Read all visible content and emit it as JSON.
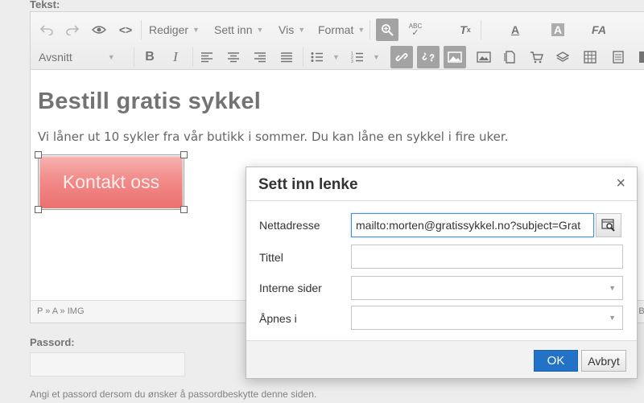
{
  "form": {
    "tekst_label": "Tekst:",
    "passord_label": "Passord:",
    "passord_value": "",
    "passord_hint": "Angi et passord dersom du ønsker å passordbeskytte denne siden."
  },
  "toolbar": {
    "menus": {
      "rediger": "Rediger",
      "sett_inn": "Sett inn",
      "vis": "Vis",
      "format": "Format"
    },
    "block_format": "Avsnitt",
    "source_code_glyph": "<>",
    "bold_glyph": "B",
    "italic_glyph": "I",
    "spellcheck_glyph": "ABC",
    "icons": [
      "undo-icon",
      "redo-icon",
      "preview-icon",
      "source-code-icon",
      "search-replace-icon",
      "spellcheck-icon",
      "clear-format-icon",
      "text-color-icon",
      "background-color-icon",
      "font-size-icon",
      "bold-icon",
      "italic-icon",
      "align-left-icon",
      "align-center-icon",
      "align-right-icon",
      "justify-icon",
      "bullet-list-icon",
      "numbered-list-icon",
      "link-icon",
      "unlink-icon",
      "image-icon",
      "media-icon",
      "template-icon",
      "cart-icon",
      "layers-icon",
      "table-icon",
      "document-icon"
    ]
  },
  "content": {
    "heading": "Bestill gratis sykkel",
    "paragraph": "Vi låner ut 10 sykler fra vår butikk i sommer. Du kan låne en sykkel i fire uker.",
    "image_button_text": "Kontakt oss"
  },
  "statusbar": {
    "path": "P » A » IMG",
    "right": "BY"
  },
  "dialog": {
    "title": "Sett inn lenke",
    "close_glyph": "×",
    "fields": {
      "url_label": "Nettadresse",
      "url_value": "mailto:morten@gratissykkel.no?subject=Grat",
      "title_label": "Tittel",
      "title_value": "",
      "internal_label": "Interne sider",
      "internal_value": "",
      "target_label": "Åpnes i",
      "target_value": ""
    },
    "ok_label": "OK",
    "cancel_label": "Avbryt"
  },
  "colors": {
    "accent": "#2273c8",
    "button_red": "#ef7370",
    "toolbar_active": "#8f8f8f"
  }
}
